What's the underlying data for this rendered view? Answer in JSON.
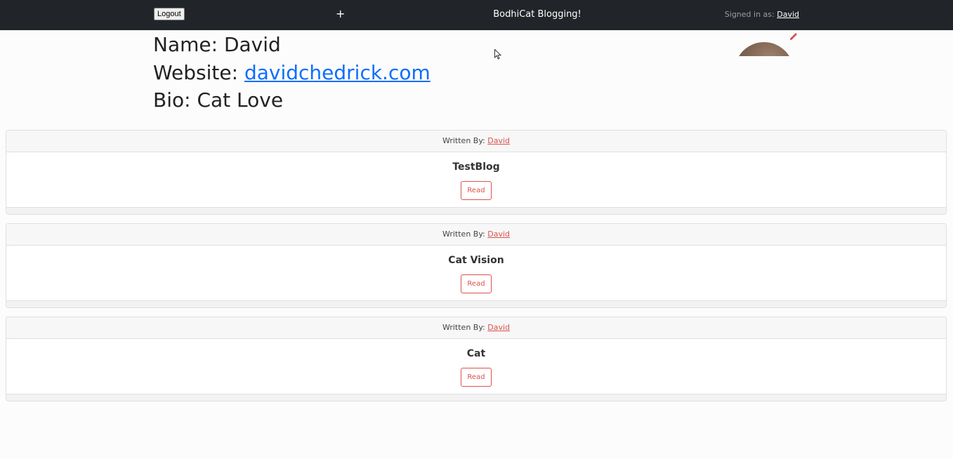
{
  "navbar": {
    "logout_label": "Logout",
    "add_label": "+",
    "brand": "BodhiCat Blogging!",
    "signed_in_prefix": "Signed in as: ",
    "signed_in_user": "David"
  },
  "profile": {
    "name_prefix": "Name: ",
    "name": "David",
    "website_prefix": "Website: ",
    "website": "davidchedrick.com",
    "bio_prefix": "Bio: ",
    "bio": "Cat Love",
    "edit_icon": "pencil-icon"
  },
  "posts": [
    {
      "written_by_prefix": "Written By: ",
      "author": "David",
      "title": "TestBlog",
      "read_label": "Read"
    },
    {
      "written_by_prefix": "Written By: ",
      "author": "David",
      "title": "Cat Vision",
      "read_label": "Read"
    },
    {
      "written_by_prefix": "Written By: ",
      "author": "David",
      "title": "Cat",
      "read_label": "Read"
    }
  ],
  "colors": {
    "navbar_bg": "#212529",
    "link_blue": "#0d6efd",
    "accent_red": "#d9534f"
  }
}
